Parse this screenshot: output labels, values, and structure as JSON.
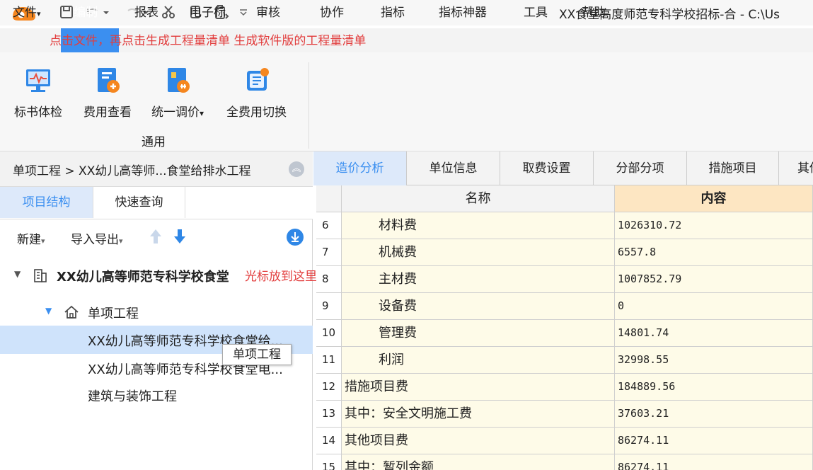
{
  "title": "XX食堂高度师范专科学校招标-合 - C:\\Us",
  "menu": [
    "文件",
    "编制",
    "报表",
    "电子标",
    "审核",
    "协作",
    "指标",
    "指标神器",
    "工具",
    "帮助"
  ],
  "overlay_hint": "点击文件，再点击生成工程量清单 生成软件版的工程量清单",
  "ribbon": {
    "buttons": [
      "标书体检",
      "费用查看",
      "统一调价",
      "全费用切换"
    ],
    "dropdown_marker": "▾",
    "group": "通用"
  },
  "breadcrumb": "单项工程 > XX幼儿高等师...食堂给排水工程",
  "left_tabs": [
    "项目结构",
    "快速查询"
  ],
  "left_toolbar": {
    "new": "新建",
    "import_export": "导入导出"
  },
  "tree": {
    "root": "XX幼儿高等师范专科学校食堂",
    "cursor_hint": "光标放到这里",
    "group": "单项工程",
    "items": [
      "XX幼儿高等师范专科学校食堂给...",
      "XX幼儿高等师范专科学校食堂电...",
      "建筑与装饰工程"
    ]
  },
  "tooltip": "单项工程",
  "right_tabs": [
    "造价分析",
    "单位信息",
    "取费设置",
    "分部分项",
    "措施项目",
    "其他"
  ],
  "table": {
    "headers": {
      "name": "名称",
      "content": "内容"
    },
    "rows": [
      {
        "no": "6",
        "name": "材料费",
        "value": "1026310.72"
      },
      {
        "no": "7",
        "name": "机械费",
        "value": "6557.8"
      },
      {
        "no": "8",
        "name": "主材费",
        "value": "1007852.79"
      },
      {
        "no": "9",
        "name": "设备费",
        "value": "0"
      },
      {
        "no": "10",
        "name": "管理费",
        "value": "14801.74"
      },
      {
        "no": "11",
        "name": "利润",
        "value": "32998.55"
      },
      {
        "no": "12",
        "name": "措施项目费",
        "value": "184889.56"
      },
      {
        "no": "13",
        "name": "其中：安全文明施工费",
        "value": "37603.21"
      },
      {
        "no": "14",
        "name": "其他项目费",
        "value": "86274.11"
      },
      {
        "no": "15",
        "name": "其中：暂列金额",
        "value": "86274.11"
      }
    ]
  },
  "colors": {
    "accent": "#3b8ff0",
    "hint_red": "#e23d3d",
    "row_bg": "#fefbe8",
    "logo_orange": "#f5861f"
  }
}
